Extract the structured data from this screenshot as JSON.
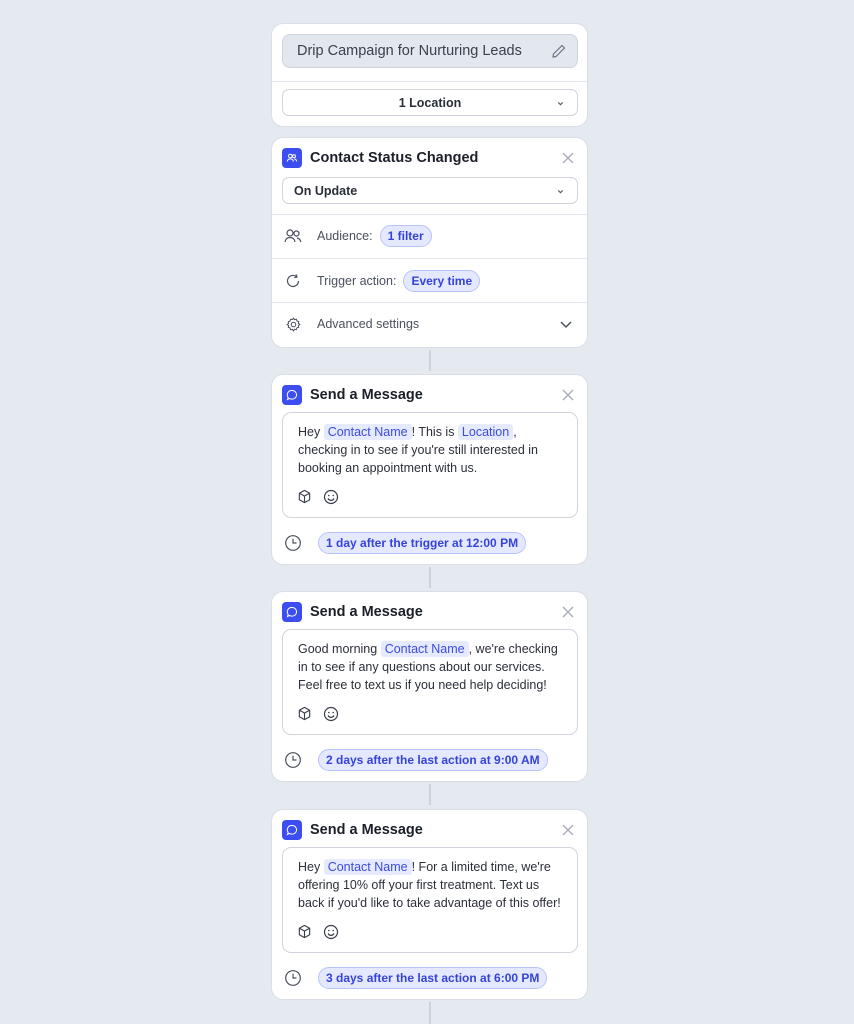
{
  "campaign": {
    "name": "Drip Campaign for Nurturing Leads",
    "location_select": "1 Location"
  },
  "trigger": {
    "title": "Contact Status Changed",
    "event_select": "On Update",
    "audience_label": "Audience:",
    "audience_value": "1 filter",
    "trigger_action_label": "Trigger action:",
    "trigger_action_value": "Every time",
    "advanced_label": "Advanced settings"
  },
  "messages": [
    {
      "title": "Send a Message",
      "parts": [
        "Hey ",
        "Contact Name",
        "! This is ",
        "Location",
        ", checking in to see if you're still interested in booking an appointment with us."
      ],
      "schedule": "1 day after the trigger at 12:00 PM"
    },
    {
      "title": "Send a Message",
      "parts": [
        "Good morning ",
        "Contact Name",
        ", we're checking in to see if any questions about our services. Feel free to text us if you need help deciding!"
      ],
      "schedule": "2 days after the last action at 9:00 AM"
    },
    {
      "title": "Send a Message",
      "parts": [
        "Hey ",
        "Contact Name",
        "! For a limited time, we're offering 10% off your first treatment. Text us back if you'd like to take advantage of this offer!"
      ],
      "schedule": "3 days after the last action at 6:00 PM"
    }
  ],
  "colors": {
    "accent": "#3d4ef0",
    "pill_bg": "#e5e9ff",
    "pill_text": "#3443d9",
    "background": "#e5e9f0"
  }
}
